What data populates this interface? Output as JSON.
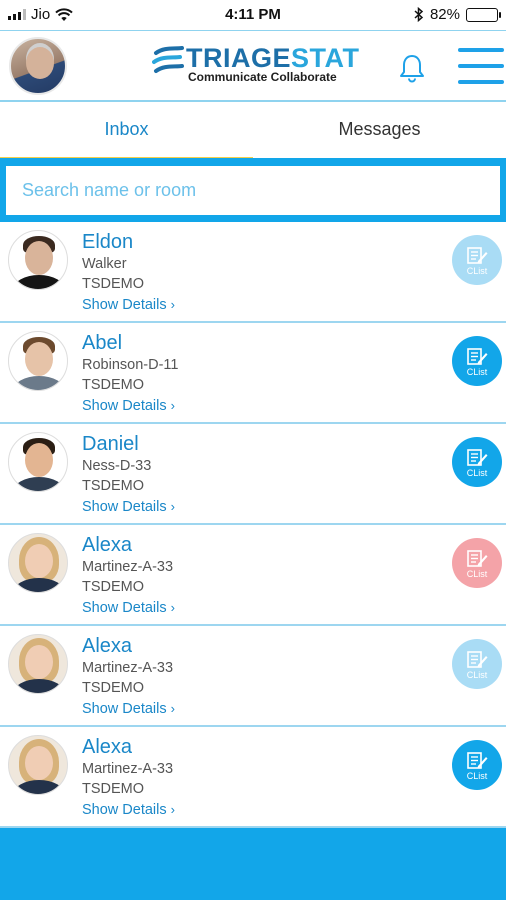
{
  "status_bar": {
    "carrier": "Jio",
    "time": "4:11 PM",
    "battery_percent": "82%",
    "battery_level": 0.82,
    "icons": [
      "signal-icon",
      "wifi-icon",
      "bluetooth-icon",
      "battery-icon"
    ]
  },
  "header": {
    "logo_text_bold": "TRIAGE",
    "logo_text_light": "STAT",
    "logo_tagline": "Communicate Collaborate",
    "icons": [
      "avatar",
      "bell-icon",
      "menu-icon"
    ]
  },
  "tabs": [
    {
      "label": "Inbox",
      "active": true
    },
    {
      "label": "Messages",
      "active": false
    }
  ],
  "search": {
    "placeholder": "Search name or room",
    "value": ""
  },
  "list": {
    "items": [
      {
        "name": "Eldon",
        "sub": "Walker",
        "org": "TSDEMO",
        "link": "Show Details",
        "clist_label": "CList",
        "clist_color": "#a9dcf5"
      },
      {
        "name": "Abel",
        "sub": "Robinson-D-11",
        "org": "TSDEMO",
        "link": "Show Details",
        "clist_label": "CList",
        "clist_color": "#12a6e9"
      },
      {
        "name": "Daniel",
        "sub": "Ness-D-33",
        "org": "TSDEMO",
        "link": "Show Details",
        "clist_label": "CList",
        "clist_color": "#12a6e9"
      },
      {
        "name": "Alexa",
        "sub": "Martinez-A-33",
        "org": "TSDEMO",
        "link": "Show Details",
        "clist_label": "CList",
        "clist_color": "#f4a3a8"
      },
      {
        "name": "Alexa",
        "sub": "Martinez-A-33",
        "org": "TSDEMO",
        "link": "Show Details",
        "clist_label": "CList",
        "clist_color": "#a9dcf5"
      },
      {
        "name": "Alexa",
        "sub": "Martinez-A-33",
        "org": "TSDEMO",
        "link": "Show Details",
        "clist_label": "CList",
        "clist_color": "#12a6e9"
      }
    ]
  },
  "colors": {
    "accent": "#12a6e9",
    "link": "#1a87c8",
    "tab_indicator": "#f3cf4a"
  }
}
